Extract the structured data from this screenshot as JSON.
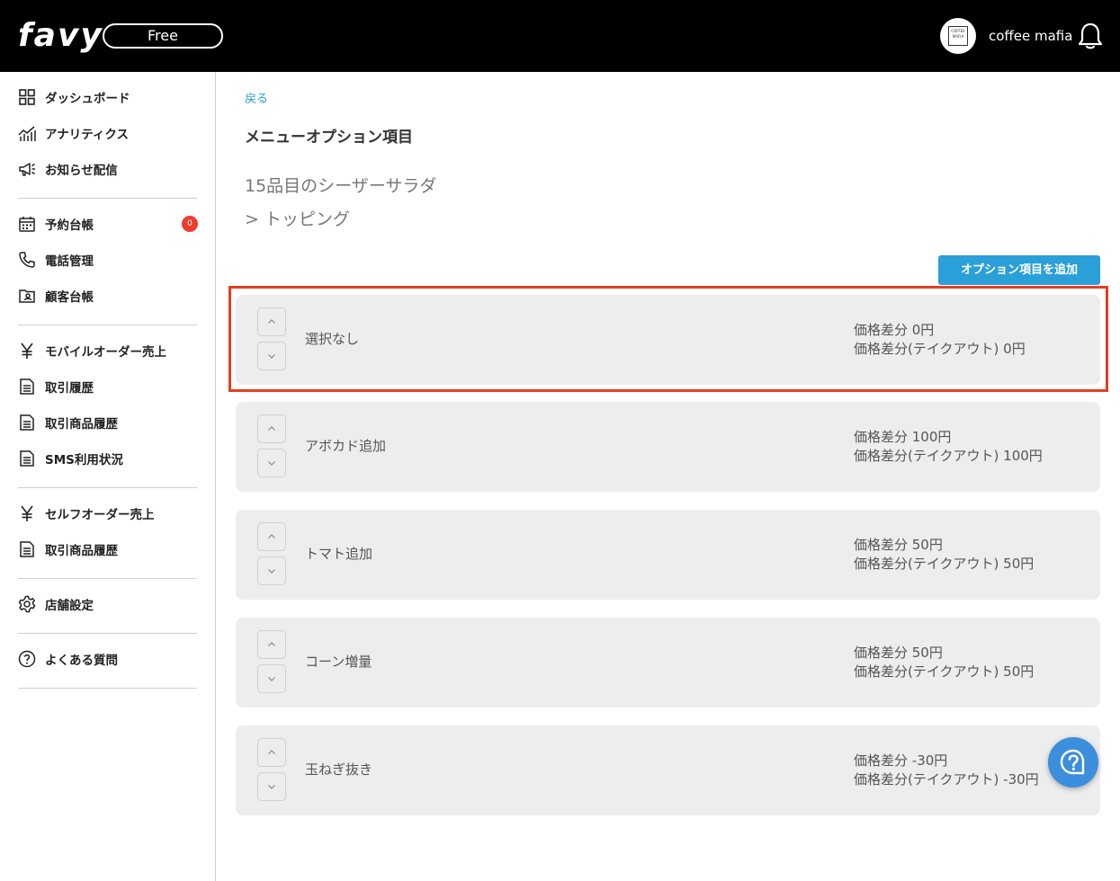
{
  "header": {
    "logo": "favy",
    "plan": "Free",
    "avatar_text": "COFFEE MAFIA",
    "store_name": "coffee mafia"
  },
  "sidebar": {
    "items": [
      {
        "label": "ダッシュボード",
        "icon": "grid-icon"
      },
      {
        "label": "アナリティクス",
        "icon": "analytics-icon"
      },
      {
        "label": "お知らせ配信",
        "icon": "megaphone-icon"
      },
      {
        "label": "予約台帳",
        "icon": "calendar-icon",
        "badge": "0"
      },
      {
        "label": "電話管理",
        "icon": "phone-icon"
      },
      {
        "label": "顧客台帳",
        "icon": "contact-card-icon"
      },
      {
        "label": "モバイルオーダー売上",
        "icon": "yen-icon"
      },
      {
        "label": "取引履歴",
        "icon": "document-icon"
      },
      {
        "label": "取引商品履歴",
        "icon": "document-icon"
      },
      {
        "label": "SMS利用状況",
        "icon": "document-icon"
      },
      {
        "label": "セルフオーダー売上",
        "icon": "yen-icon"
      },
      {
        "label": "取引商品履歴",
        "icon": "document-icon"
      },
      {
        "label": "店舗設定",
        "icon": "gear-icon"
      },
      {
        "label": "よくある質問",
        "icon": "question-icon"
      }
    ]
  },
  "main": {
    "back_label": "戻る",
    "title": "メニューオプション項目",
    "item_name": "15品目のシーザーサラダ",
    "option_group": "> トッピング",
    "add_button": "オプション項目を追加",
    "options": [
      {
        "name": "選択なし",
        "price": "価格差分 0円",
        "takeout_price": "価格差分(テイクアウト) 0円"
      },
      {
        "name": "アボカド追加",
        "price": "価格差分 100円",
        "takeout_price": "価格差分(テイクアウト) 100円"
      },
      {
        "name": "トマト追加",
        "price": "価格差分 50円",
        "takeout_price": "価格差分(テイクアウト) 50円"
      },
      {
        "name": "コーン増量",
        "price": "価格差分 50円",
        "takeout_price": "価格差分(テイクアウト) 50円"
      },
      {
        "name": "玉ねぎ抜き",
        "price": "価格差分 -30円",
        "takeout_price": "価格差分(テイクアウト) -30円"
      }
    ]
  },
  "colors": {
    "accent": "#2a9fd8",
    "highlight": "#e43e21",
    "badge": "#ee3b2b",
    "card_bg": "#ededed"
  }
}
